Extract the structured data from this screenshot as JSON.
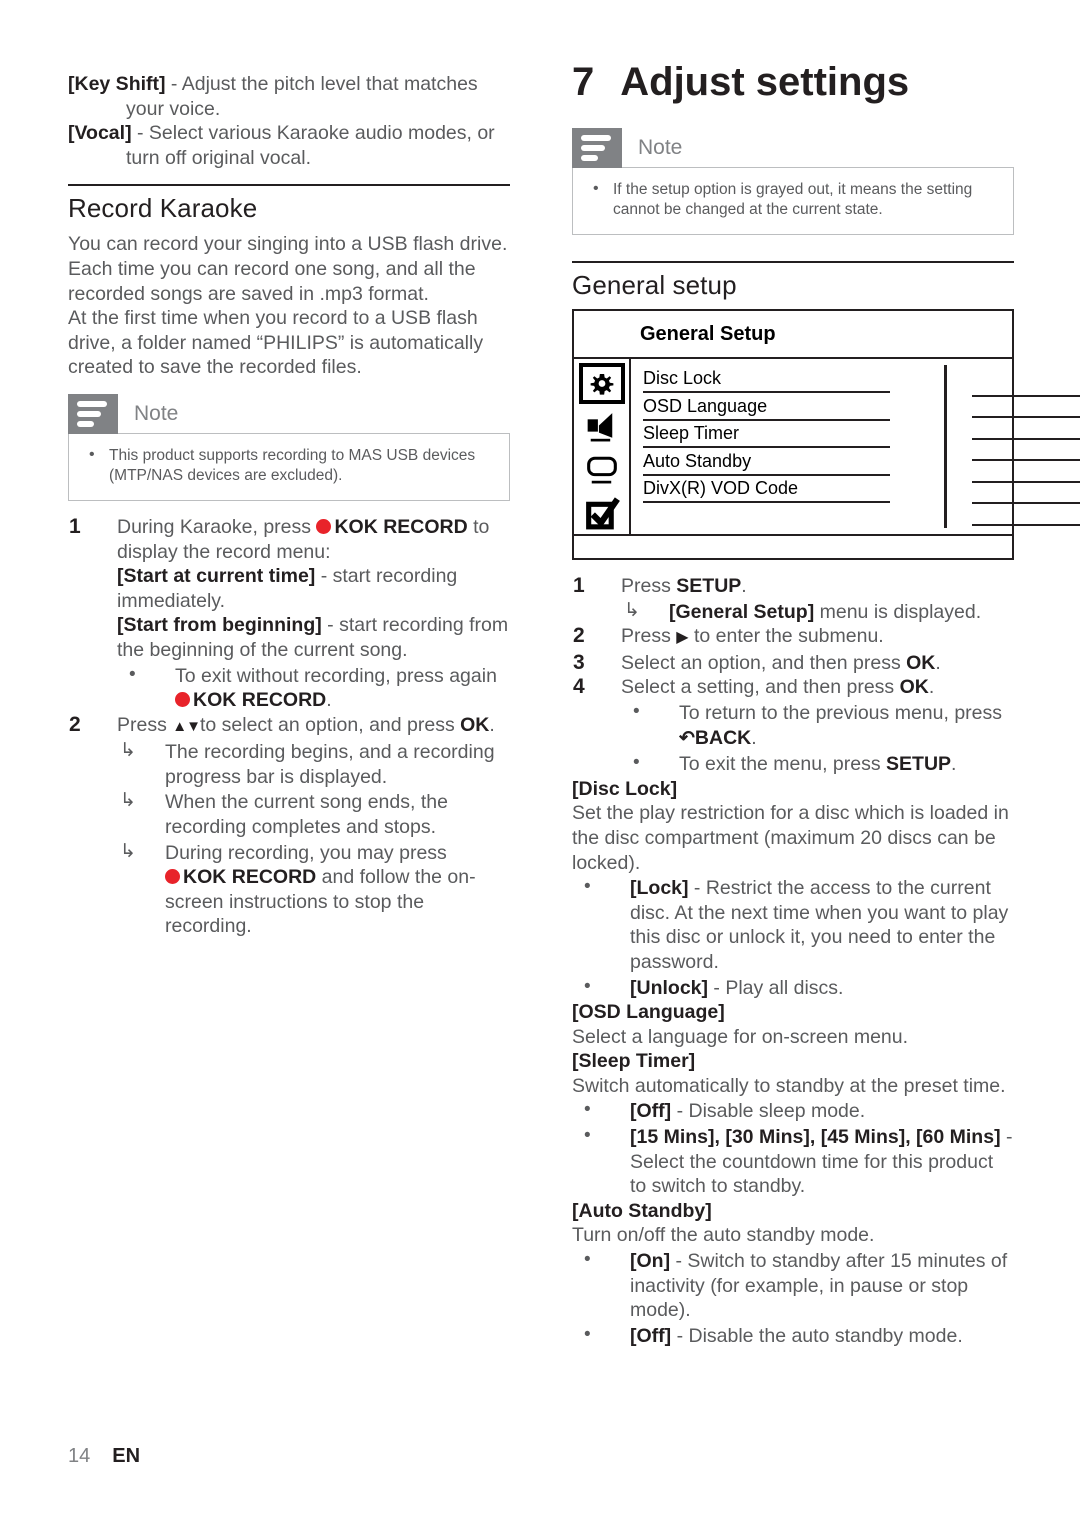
{
  "footer": {
    "page_number": "14",
    "language_code": "EN"
  },
  "colors": {
    "red_accent": "#e8232a",
    "note_gray": "#808285",
    "body_text": "#5a5b5d",
    "heading": "#231f20"
  },
  "left_column": {
    "intro_items": [
      {
        "term": "[Key Shift]",
        "rest": " - Adjust the pitch level that matches your voice."
      },
      {
        "term": "[Vocal]",
        "rest": " - Select various Karaoke audio modes, or turn off original vocal."
      }
    ],
    "section_heading": "Record Karaoke",
    "paragraphs": [
      "You can record your singing into a USB flash drive. Each time you can record one song, and all the recorded songs are saved in .mp3 format.",
      "At the first time when you record to a USB flash drive, a folder named “PHILIPS” is automatically created to save the recorded files."
    ],
    "note": {
      "icon": "note-lines-icon",
      "label": "Note",
      "items": [
        "This product supports recording to MAS USB devices (MTP/NAS devices are excluded)."
      ]
    },
    "steps": [
      {
        "number": "1",
        "text_before_icon": "During Karaoke, press ",
        "icon": "red-record-dot-icon",
        "bold_key": "KOK RECORD",
        "text_after": " to display the record menu:",
        "options": [
          {
            "term": "[Start at current time]",
            "rest": " - start recording immediately."
          },
          {
            "term": "[Start from beginning]",
            "rest": " - start recording from the beginning of the current song."
          }
        ],
        "bullets": [
          {
            "text": "To exit without recording, press again ",
            "icon": "red-record-dot-icon",
            "bold_key": "KOK RECORD",
            "tail": "."
          }
        ]
      },
      {
        "number": "2",
        "text_before_icon": "Press ",
        "glyph": "▲▼",
        "text_after": "to select an option, and press ",
        "bold_key": "OK",
        "tail": ".",
        "results": [
          {
            "text": "The recording begins, and a recording progress bar is displayed."
          },
          {
            "text": "When the current song ends, the recording completes and stops."
          },
          {
            "text_lead": "During recording, you may press ",
            "icon": "red-record-dot-icon",
            "bold_key": "KOK RECORD",
            "text_tail": " and follow the on-screen instructions to stop the recording."
          }
        ]
      }
    ]
  },
  "right_column": {
    "chapter": {
      "number": "7",
      "title": "Adjust settings"
    },
    "note": {
      "icon": "note-lines-icon",
      "label": "Note",
      "items": [
        "If the setup option is grayed out, it means the setting cannot be changed at the current state."
      ]
    },
    "section_heading": "General setup",
    "osd_menu": {
      "title": "General Setup",
      "icons": [
        {
          "name": "gear-icon",
          "selected": true
        },
        {
          "name": "speaker-icon",
          "selected": false
        },
        {
          "name": "video-screen-icon",
          "selected": false
        },
        {
          "name": "checkbox-check-icon",
          "selected": false
        }
      ],
      "menu_items": [
        "Disc Lock",
        "OSD Language",
        "Sleep Timer",
        "Auto Standby",
        "DivX(R) VOD Code"
      ],
      "value_line_count": 7
    },
    "steps": [
      {
        "number": "1",
        "text": "Press ",
        "bold_key": "SETUP",
        "tail": ".",
        "results": [
          {
            "bold": "[General Setup]",
            "rest": " menu is displayed."
          }
        ]
      },
      {
        "number": "2",
        "text": "Press ",
        "glyph": "▶",
        "text_after": " to enter the submenu."
      },
      {
        "number": "3",
        "text": "Select an option, and then press ",
        "bold_key": "OK",
        "tail": "."
      },
      {
        "number": "4",
        "text": "Select a setting, and then press ",
        "bold_key": "OK",
        "tail": ".",
        "bullets": [
          {
            "text": "To return to the previous menu, press ",
            "icon": "back-arrow-icon",
            "bold_key": "BACK",
            "tail": "."
          },
          {
            "text": "To exit the menu, press ",
            "bold_key": "SETUP",
            "tail": "."
          }
        ]
      }
    ],
    "settings": [
      {
        "term": "[Disc Lock]",
        "description": "Set the play restriction for a disc which is loaded in the disc compartment (maximum 20 discs can be locked).",
        "bullets": [
          {
            "term": "[Lock]",
            "rest": " - Restrict the access to the current disc. At the next time when you want to play this disc or unlock it, you need to enter the password."
          },
          {
            "term": "[Unlock]",
            "rest": " - Play all discs."
          }
        ]
      },
      {
        "term": "[OSD Language]",
        "description": "Select a language for on-screen menu.",
        "bullets": []
      },
      {
        "term": "[Sleep Timer]",
        "description": "Switch automatically to standby at the preset time.",
        "bullets": [
          {
            "term": "[Off]",
            "rest": " - Disable sleep mode."
          },
          {
            "term": "[15 Mins], [30 Mins], [45 Mins], [60 Mins]",
            "rest": " - Select the countdown time for this product to switch to standby."
          }
        ]
      },
      {
        "term": "[Auto Standby]",
        "description": "Turn on/off the auto standby mode.",
        "bullets": [
          {
            "term": "[On]",
            "rest": " - Switch to standby after 15 minutes of inactivity (for example, in pause or stop mode)."
          },
          {
            "term": "[Off]",
            "rest": " - Disable the auto standby mode."
          }
        ]
      }
    ]
  }
}
